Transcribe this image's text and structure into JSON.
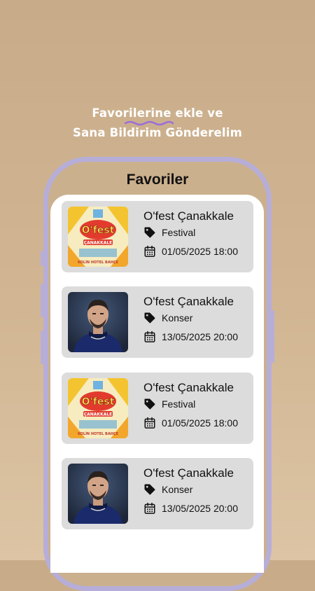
{
  "promo": {
    "line1": "Favorilerine ekle ve",
    "line2": "Sana Bildirim Gönderelim"
  },
  "screen": {
    "title": "Favoriler"
  },
  "favorites": [
    {
      "title": "O'fest Çanakkale",
      "category": "Festival",
      "date": "01/05/2025 18:00",
      "image": "fest-poster"
    },
    {
      "title": "O'fest Çanakkale",
      "category": "Konser",
      "date": "13/05/2025 20:00",
      "image": "artist-photo"
    },
    {
      "title": "O'fest Çanakkale",
      "category": "Festival",
      "date": "01/05/2025 18:00",
      "image": "fest-poster"
    },
    {
      "title": "O'fest Çanakkale",
      "category": "Konser",
      "date": "13/05/2025 20:00",
      "image": "artist-photo"
    }
  ],
  "poster": {
    "logo_text": "O'fest",
    "logo_sub": "ÇANAKKALE",
    "venue": "KOLİN HOTEL BAHÇE"
  },
  "icons": {
    "category": "tag-icon",
    "date": "calendar-icon"
  },
  "colors": {
    "background": "#c8ac8a",
    "phone_frame": "#b6aed8",
    "card": "#dcdcdc",
    "accent_wave": "#9b6fd8"
  }
}
